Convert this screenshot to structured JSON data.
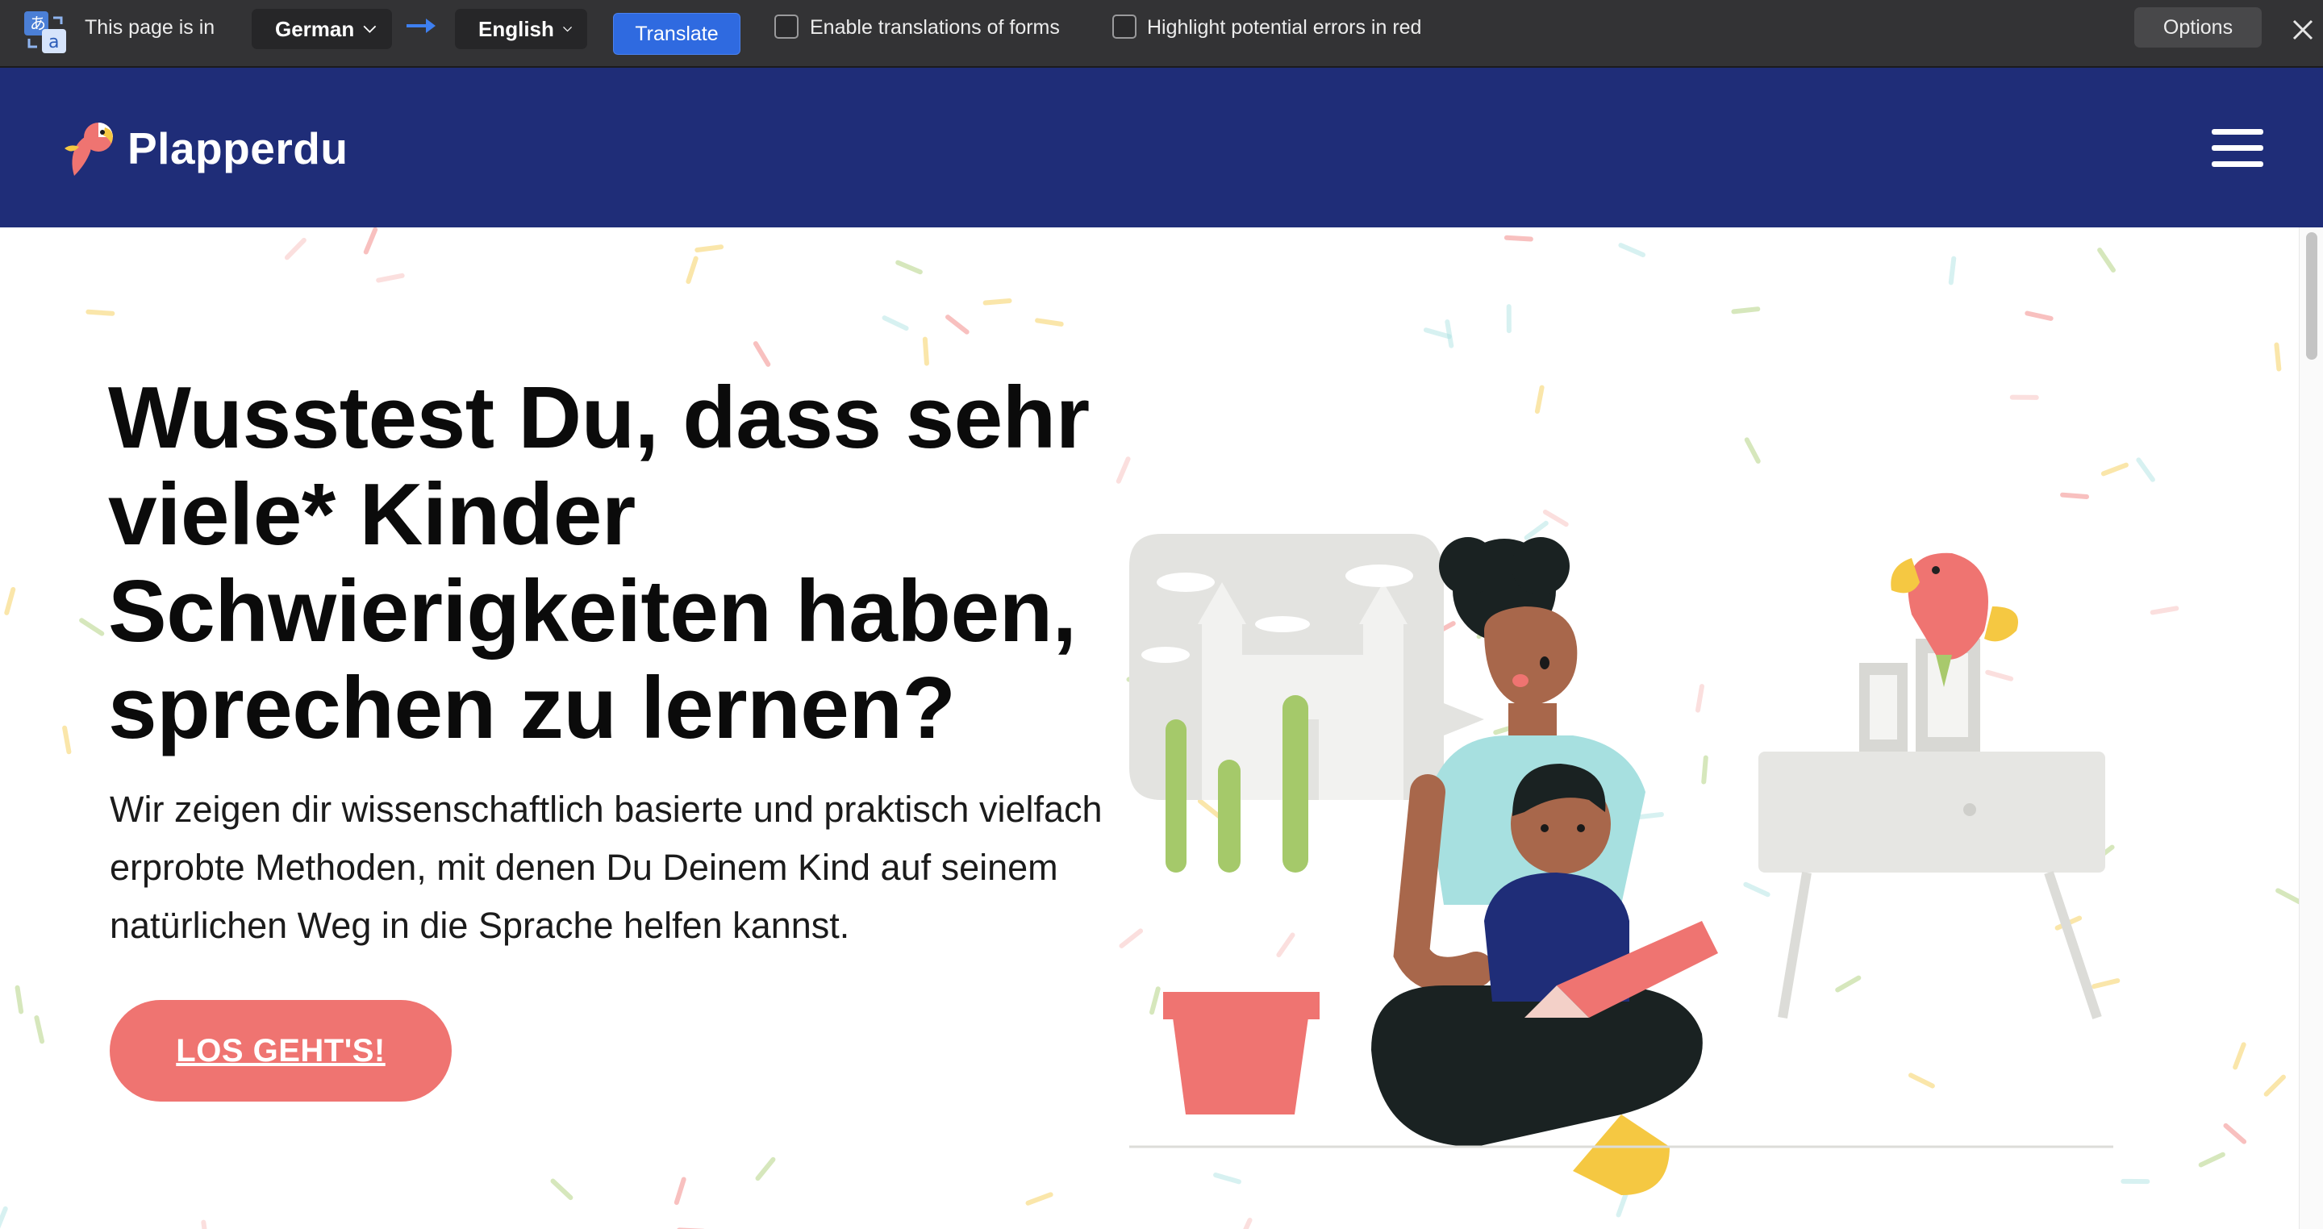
{
  "translate_bar": {
    "page_is_in_label": "This page is in",
    "source_language": "German",
    "target_language": "English",
    "translate_button": "Translate",
    "forms_checkbox_label": "Enable translations of forms",
    "forms_checked": false,
    "highlight_checkbox_label": "Highlight potential errors in red",
    "highlight_checked": false,
    "options_button": "Options"
  },
  "site_header": {
    "brand": "Plapperdu",
    "menu_icon": "hamburger-menu-icon"
  },
  "hero": {
    "headline": "Wusstest Du, dass sehr viele* Kinder Schwierigkeiten haben, sprechen zu lernen?",
    "subtext": "Wir zeigen dir wissenschaftlich basierte und praktisch vielfach erprobte Methoden, mit denen Du Deinem Kind auf seinem natürlichen Weg in die Sprache helfen kannst.",
    "cta_label": "LOS GEHT'S!"
  },
  "colors": {
    "header_bg": "#1f2d78",
    "cta_bg": "#ef7471",
    "translate_bar_bg": "#333335",
    "translate_button_bg": "#2f6ae0"
  }
}
